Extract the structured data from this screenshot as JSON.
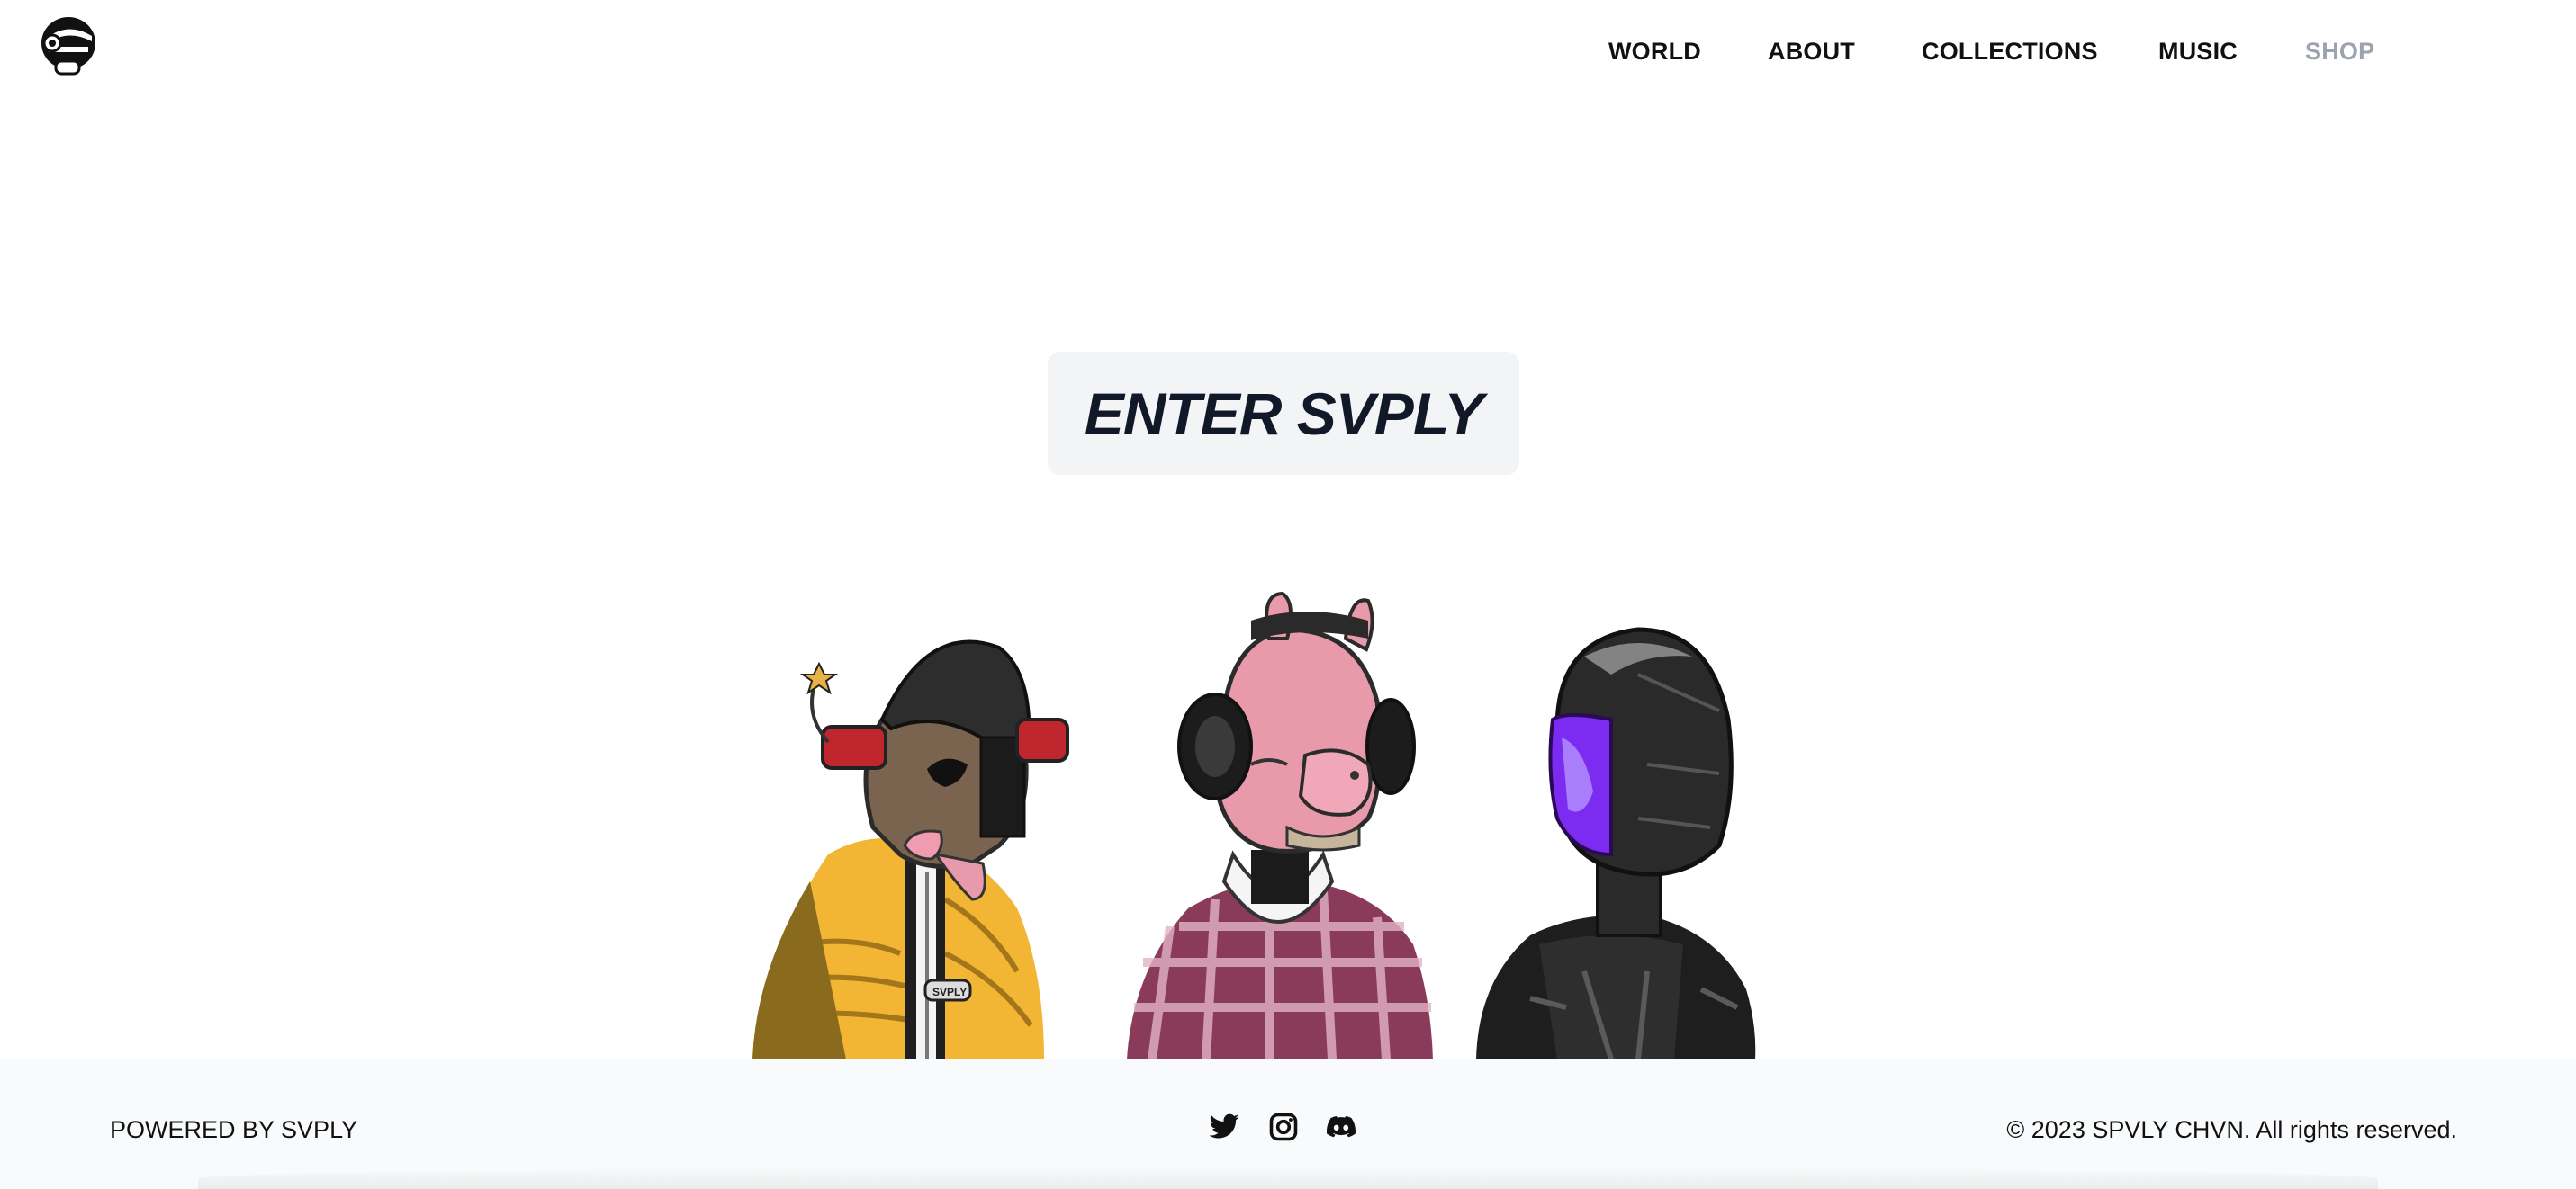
{
  "header": {
    "logo_icon": "helmet-logo-icon",
    "nav": [
      {
        "label": "WORLD"
      },
      {
        "label": "ABOUT"
      },
      {
        "label": "COLLECTIONS"
      },
      {
        "label": "MUSIC"
      },
      {
        "label": "SHOP"
      }
    ]
  },
  "hero": {
    "cta_label": "ENTER SVPLY",
    "characters": [
      {
        "name": "skull-puffer-jacket-character",
        "jacket_color": "#f2b534"
      },
      {
        "name": "pink-rabbit-plaid-character",
        "head_color": "#e89aab"
      },
      {
        "name": "chrome-helmet-character",
        "visor_color": "#7b2cf0"
      }
    ],
    "jacket_badge": "SVPLY"
  },
  "footer": {
    "powered_by": "POWERED BY SVPLY",
    "social_icons": [
      "twitter-icon",
      "instagram-icon",
      "discord-icon"
    ],
    "copyright": "© 2023 SPVLY CHVN. All rights reserved."
  },
  "colors": {
    "text": "#111111",
    "muted_nav": "#9ca3af",
    "cta_bg": "#f3f4f6",
    "cta_text": "#111827",
    "footer_bg": "#f9fafb"
  }
}
